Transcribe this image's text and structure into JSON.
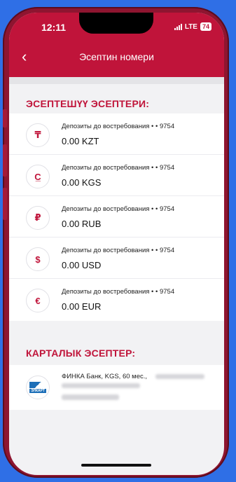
{
  "status_bar": {
    "time": "12:11",
    "network": "LTE",
    "battery": "74"
  },
  "header": {
    "title": "Эсептин номери"
  },
  "accounts_section": {
    "title": "ЭСЕПТЕШҮҮ ЭСЕПТЕРИ:",
    "items": [
      {
        "icon_glyph": "₸",
        "name": "Депозиты до востребования  • • 9754",
        "amount": "0.00 KZT"
      },
      {
        "icon_glyph": "C̲",
        "name": "Депозиты до востребования  • • 9754",
        "amount": "0.00 KGS"
      },
      {
        "icon_glyph": "₽",
        "name": "Депозиты до востребования  • • 9754",
        "amount": "0.00 RUB"
      },
      {
        "icon_glyph": "$",
        "name": "Депозиты до востребования  • • 9754",
        "amount": "0.00 USD"
      },
      {
        "icon_glyph": "€",
        "name": "Депозиты до востребования  • • 9754",
        "amount": "0.00 EUR"
      }
    ]
  },
  "cards_section": {
    "title": "КАРТАЛЫК ЭСЕПТЕР:",
    "items": [
      {
        "logo_text": "ЭЛКАРТ",
        "name": "ФИНКА Банк, KGS, 60 мес.,"
      }
    ]
  },
  "colors": {
    "brand": "#c0143a",
    "frame": "#8e1530",
    "background": "#2f6fe6"
  }
}
